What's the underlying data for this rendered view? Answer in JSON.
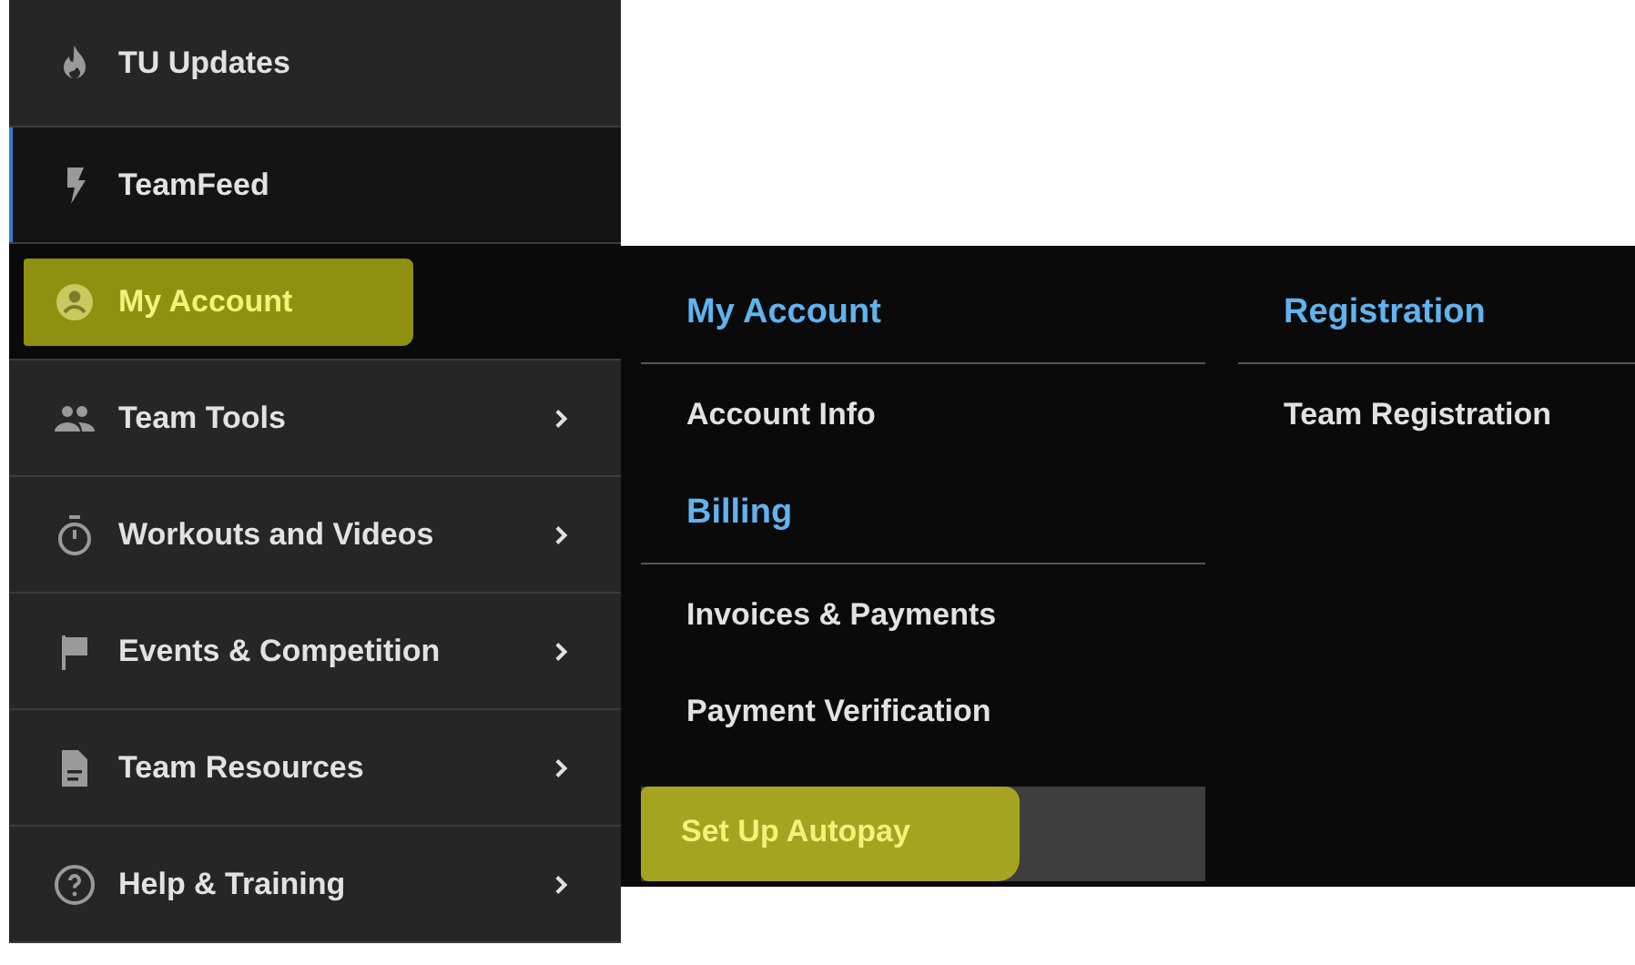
{
  "sidebar": {
    "items": [
      {
        "label": "TU Updates",
        "kind": "flame",
        "selected": false,
        "highlighted": false,
        "has_submenu": false
      },
      {
        "label": "TeamFeed",
        "kind": "bolt",
        "selected": true,
        "highlighted": false,
        "has_submenu": false
      },
      {
        "label": "My Account",
        "kind": "account",
        "selected": false,
        "highlighted": true,
        "has_submenu": false
      },
      {
        "label": "Team Tools",
        "kind": "people",
        "selected": false,
        "highlighted": false,
        "has_submenu": true
      },
      {
        "label": "Workouts and Videos",
        "kind": "stopwatch",
        "selected": false,
        "highlighted": false,
        "has_submenu": true
      },
      {
        "label": "Events & Competition",
        "kind": "flag",
        "selected": false,
        "highlighted": false,
        "has_submenu": true
      },
      {
        "label": "Team Resources",
        "kind": "document",
        "selected": false,
        "highlighted": false,
        "has_submenu": true
      },
      {
        "label": "Help & Training",
        "kind": "help",
        "selected": false,
        "highlighted": false,
        "has_submenu": true
      }
    ]
  },
  "submenu": {
    "columns": [
      {
        "sections": [
          {
            "heading": "My Account",
            "links": [
              {
                "label": "Account Info",
                "selected": false,
                "highlighted": false
              }
            ]
          },
          {
            "heading": "Billing",
            "links": [
              {
                "label": "Invoices & Payments",
                "selected": false,
                "highlighted": false
              },
              {
                "label": "Payment Verification",
                "selected": false,
                "highlighted": false
              },
              {
                "label": "Set Up Autopay",
                "selected": true,
                "highlighted": true
              }
            ]
          }
        ]
      },
      {
        "sections": [
          {
            "heading": "Registration",
            "links": [
              {
                "label": "Team Registration",
                "selected": false,
                "highlighted": false
              }
            ]
          }
        ]
      }
    ]
  }
}
